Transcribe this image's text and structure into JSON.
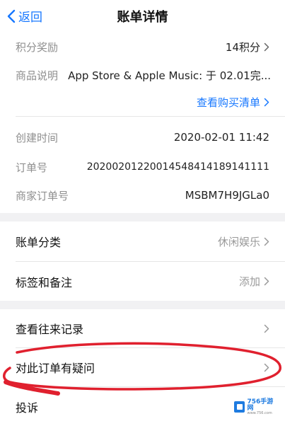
{
  "nav": {
    "back_label": "返回",
    "title": "账单详情"
  },
  "details": {
    "points_label": "积分奖励",
    "points_value": "14积分",
    "product_label": "商品说明",
    "product_value": "App Store & Apple Music: 于 02.01完...",
    "purchase_list_link": "查看购买清单"
  },
  "order": {
    "created_label": "创建时间",
    "created_value": "2020-02-01 11:42",
    "order_no_label": "订单号",
    "order_no_value": "20200201220014548414189141111",
    "merchant_order_label": "商家订单号",
    "merchant_order_value": "MSBM7H9JGLa0"
  },
  "category": {
    "label": "账单分类",
    "value": "休闲娱乐"
  },
  "tags": {
    "label": "标签和备注",
    "value": "添加"
  },
  "actions": {
    "history_label": "查看往来记录",
    "question_label": "对此订单有疑问",
    "complaint_label": "投诉"
  },
  "watermark": {
    "brand": "756手游网",
    "url": "www.756.com"
  },
  "colors": {
    "accent": "#1677ff",
    "annotation": "#e0202e"
  }
}
